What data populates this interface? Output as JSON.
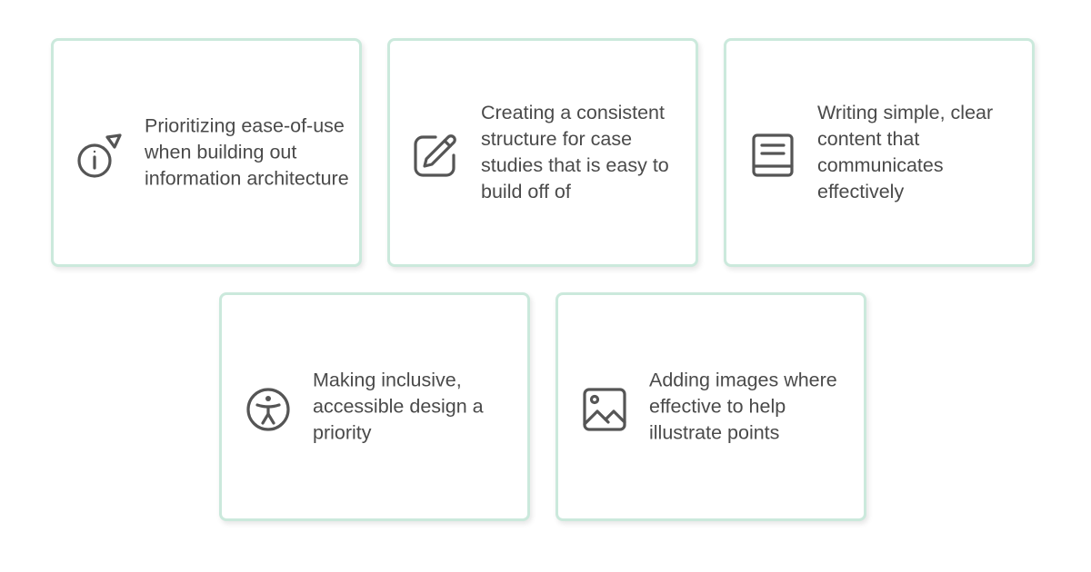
{
  "cards": [
    {
      "icon": "info-cursor-icon",
      "text": "Prioritizing ease-of-use when building out information architecture"
    },
    {
      "icon": "link-edit-icon",
      "text": "Creating a consistent structure for case studies that is easy to build off of"
    },
    {
      "icon": "book-icon",
      "text": "Writing simple, clear content that communicates effectively"
    },
    {
      "icon": "accessibility-icon",
      "text": "Making inclusive, accessible design a priority"
    },
    {
      "icon": "image-icon",
      "text": "Adding images where effective to help illustrate points"
    }
  ],
  "colors": {
    "card_border": "#cbe9dc",
    "icon_stroke": "#555555",
    "text": "#4a4a4a"
  }
}
